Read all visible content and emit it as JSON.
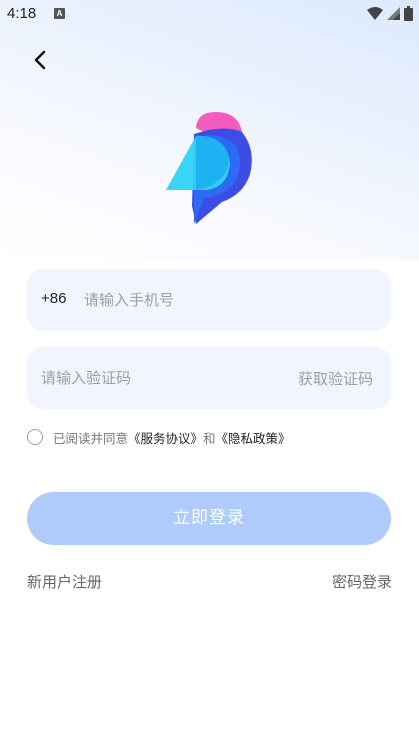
{
  "status_bar": {
    "time": "4:18",
    "app_icon_letter": "A",
    "icons": [
      "wifi-icon",
      "signal-icon",
      "battery-icon"
    ]
  },
  "nav": {
    "back_icon": "chevron-left-icon"
  },
  "logo": {
    "icon": "bird-logo-icon",
    "colors": [
      "#f35bbd",
      "#2fd3f5",
      "#2e6bf5",
      "#3c4de6"
    ]
  },
  "form": {
    "country_code": "+86",
    "phone_placeholder": "请输入手机号",
    "code_placeholder": "请输入验证码",
    "get_code_label": "获取验证码",
    "agreement_prefix": "已阅读并同意",
    "service_agreement": "《服务协议》",
    "and_text": "和",
    "privacy_policy": "《隐私政策》"
  },
  "login_button": {
    "label": "立即登录",
    "color": "#aecbfb"
  },
  "bottom_links": {
    "register": "新用户注册",
    "password_login": "密码登录"
  }
}
